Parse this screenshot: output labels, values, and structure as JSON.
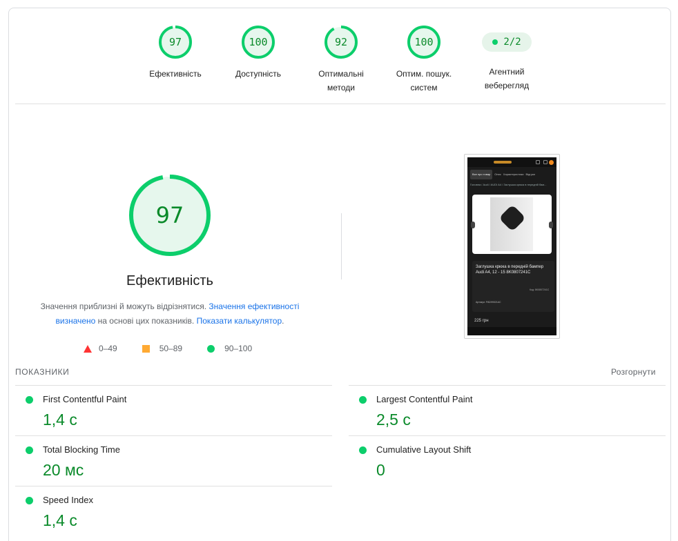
{
  "summary": [
    {
      "score": "97",
      "label_lines": [
        "Ефективність"
      ]
    },
    {
      "score": "100",
      "label_lines": [
        "Доступність"
      ]
    },
    {
      "score": "92",
      "label_lines": [
        "Оптимальні",
        "методи"
      ]
    },
    {
      "score": "100",
      "label_lines": [
        "Оптим. пошук.",
        "систем"
      ]
    }
  ],
  "agent": {
    "badge": "2/2",
    "label_lines": [
      "Агентний",
      "веберегляд"
    ]
  },
  "performance": {
    "score": "97",
    "title": "Ефективність",
    "desc_prefix": "Значення приблизні й можуть відрізнятися. ",
    "desc_link1": "Значення ефективності визначено",
    "desc_mid": " на основі цих показників. ",
    "desc_link2": "Показати калькулятор",
    "desc_suffix": "."
  },
  "legend": {
    "fail": "0–49",
    "average": "50–89",
    "pass": "90–100"
  },
  "colors": {
    "pass": "#0cce6b",
    "pass_text": "#0a8a2a",
    "average": "#ffaa33",
    "fail": "#ff3333"
  },
  "screenshot": {
    "tabs": [
      "Все про товар",
      "Опис",
      "Характеристики",
      "Відгуки"
    ],
    "breadcrumb": "Головна / Audi / AUDI A4 / Заглушка крюка в передній бам...",
    "title": "Заглушка крюка в передній бампер Audi A4, 12 - 15 8K0807241C",
    "code": "Код: 8K0807241C",
    "article": "Артикул: PAD99021AC",
    "price": "225 грн"
  },
  "metrics": {
    "header": "ПОКАЗНИКИ",
    "expand": "Розгорнути",
    "fcp": {
      "name": "First Contentful Paint",
      "value": "1,4 с"
    },
    "lcp": {
      "name": "Largest Contentful Paint",
      "value": "2,5 с"
    },
    "tbt": {
      "name": "Total Blocking Time",
      "value": "20 мс"
    },
    "cls": {
      "name": "Cumulative Layout Shift",
      "value": "0"
    },
    "si": {
      "name": "Speed Index",
      "value": "1,4 с"
    }
  }
}
